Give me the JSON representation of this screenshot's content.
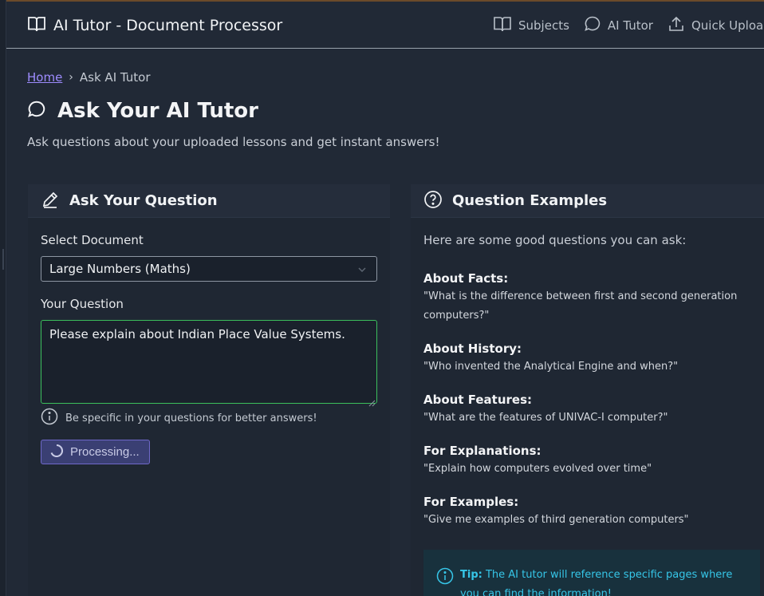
{
  "app": {
    "title": "AI Tutor - Document Processor"
  },
  "nav": {
    "items": [
      {
        "label": "Subjects",
        "icon": "book-icon"
      },
      {
        "label": "AI Tutor",
        "icon": "chat-bubble-icon"
      },
      {
        "label": "Quick Upload",
        "icon": "upload-icon"
      }
    ]
  },
  "breadcrumb": {
    "home": "Home",
    "separator": "›",
    "current": "Ask AI Tutor"
  },
  "page": {
    "title": "Ask Your AI Tutor",
    "subtitle": "Ask questions about your uploaded lessons and get instant answers!"
  },
  "ask_card": {
    "title": "Ask Your Question",
    "select_label": "Select Document",
    "selected_document": "Large Numbers (Maths)",
    "question_label": "Your Question",
    "question_value": "Please explain about Indian Place Value Systems.",
    "hint": "Be specific in your questions for better answers!",
    "button_label": "Processing..."
  },
  "examples_card": {
    "title": "Question Examples",
    "intro": "Here are some good questions you can ask:",
    "items": [
      {
        "title": "About Facts:",
        "text": "\"What is the difference between first and second generation computers?\""
      },
      {
        "title": "About History:",
        "text": "\"Who invented the Analytical Engine and when?\""
      },
      {
        "title": "About Features:",
        "text": "\"What are the features of UNIVAC-I computer?\""
      },
      {
        "title": "For Explanations:",
        "text": "\"Explain how computers evolved over time\""
      },
      {
        "title": "For Examples:",
        "text": "\"Give me examples of third generation computers\""
      }
    ],
    "tip_label": "Tip:",
    "tip_text": "The AI tutor will reference specific pages where you can find the information!"
  },
  "colors": {
    "background": "#212936",
    "link": "#9e8cff",
    "focus_border": "#3bbf5c",
    "processing_button": "#3a3f73",
    "tip_text": "#36c6e8"
  }
}
